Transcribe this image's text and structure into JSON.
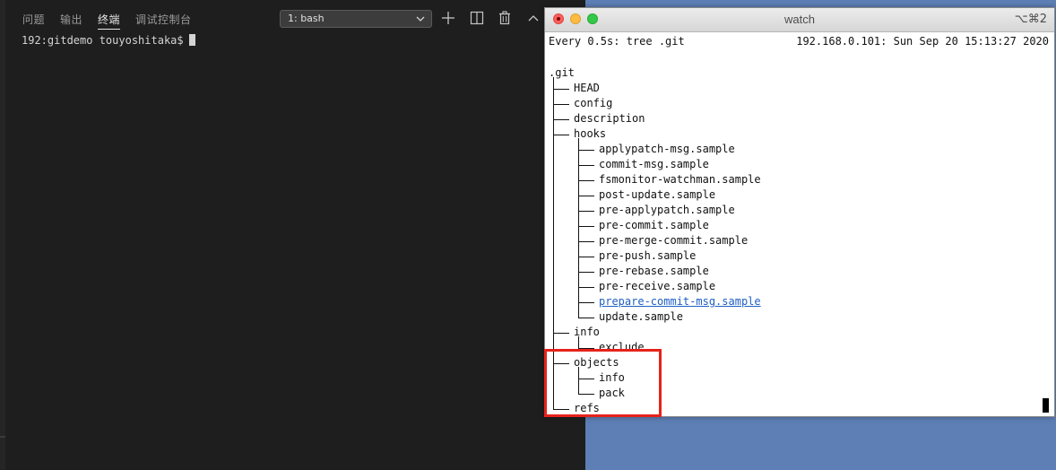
{
  "panel_tabs": [
    "问题",
    "输出",
    "终端",
    "调试控制台"
  ],
  "active_tab": "终端",
  "terminal_select": {
    "value": "1: bash"
  },
  "terminal_actions": {
    "add": "plus-icon",
    "split": "split-icon",
    "kill": "trash-icon",
    "maximize": "chevron-up-icon"
  },
  "vscode_terminal": {
    "prompt": "192:gitdemo touyoshitaka$"
  },
  "watch_window": {
    "title": "watch",
    "shortcut": "⌥⌘2",
    "header_left": "Every 0.5s: tree .git",
    "header_right": "192.168.0.101: Sun Sep 20 15:13:27 2020",
    "tree": [
      {
        "name": ".git",
        "depth": 0
      },
      {
        "name": "HEAD",
        "depth": 1
      },
      {
        "name": "config",
        "depth": 1
      },
      {
        "name": "description",
        "depth": 1
      },
      {
        "name": "hooks",
        "depth": 1
      },
      {
        "name": "applypatch-msg.sample",
        "depth": 2
      },
      {
        "name": "commit-msg.sample",
        "depth": 2
      },
      {
        "name": "fsmonitor-watchman.sample",
        "depth": 2
      },
      {
        "name": "post-update.sample",
        "depth": 2
      },
      {
        "name": "pre-applypatch.sample",
        "depth": 2
      },
      {
        "name": "pre-commit.sample",
        "depth": 2
      },
      {
        "name": "pre-merge-commit.sample",
        "depth": 2
      },
      {
        "name": "pre-push.sample",
        "depth": 2
      },
      {
        "name": "pre-rebase.sample",
        "depth": 2
      },
      {
        "name": "pre-receive.sample",
        "depth": 2
      },
      {
        "name": "prepare-commit-msg.sample",
        "depth": 2,
        "link": true
      },
      {
        "name": "update.sample",
        "depth": 2
      },
      {
        "name": "info",
        "depth": 1
      },
      {
        "name": "exclude",
        "depth": 2
      },
      {
        "name": "objects",
        "depth": 1
      },
      {
        "name": "info",
        "depth": 2
      },
      {
        "name": "pack",
        "depth": 2
      },
      {
        "name": "refs",
        "depth": 1
      }
    ]
  },
  "colors": {
    "highlight": "#e5231b",
    "link": "#1f5fc4",
    "desktop": "#5d7fb5",
    "vscode_bg": "#1e1e1e"
  }
}
